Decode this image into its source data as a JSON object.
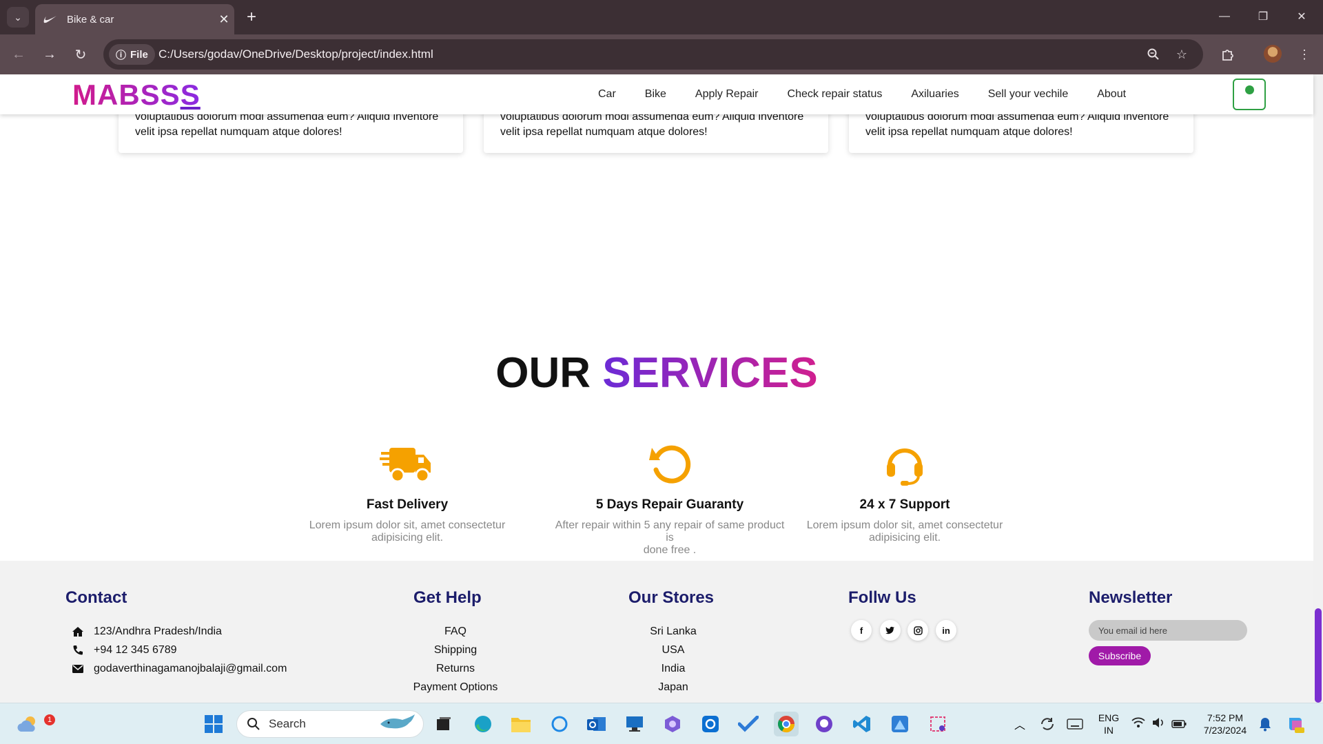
{
  "browser": {
    "tab_title": "Bike & car",
    "url": "C:/Users/godav/OneDrive/Desktop/project/index.html",
    "file_chip": "File"
  },
  "site": {
    "logo": "MABSS",
    "logo_last": "S",
    "nav": [
      "Car",
      "Bike",
      "Apply Repair",
      "Check repair status",
      "Axiluaries",
      "Sell your vechile",
      "About"
    ]
  },
  "cards": [
    {
      "text_line1": "voluptatibus dolorum modi assumenda eum? Aliquid inventore",
      "text_line2": "velit ipsa repellat numquam atque dolores!"
    },
    {
      "text_line1": "voluptatibus dolorum modi assumenda eum? Aliquid inventore",
      "text_line2": "velit ipsa repellat numquam atque dolores!"
    },
    {
      "text_line1": "voluptatibus dolorum modi assumenda eum? Aliquid inventore",
      "text_line2": "velit ipsa repellat numquam atque dolores!"
    }
  ],
  "services": {
    "title_part1": "OUR",
    "title_part2": "SERVICES",
    "items": [
      {
        "icon": "truck-fast-icon",
        "title": "Fast Delivery",
        "desc_line1": "Lorem ipsum dolor sit, amet consectetur",
        "desc_line2": "adipisicing elit."
      },
      {
        "icon": "rotate-left-icon",
        "title": "5 Days Repair Guaranty",
        "desc_line1": "After repair within 5 any repair of same product is",
        "desc_line2": "done free ."
      },
      {
        "icon": "headset-icon",
        "title": "24 x 7 Support",
        "desc_line1": "Lorem ipsum dolor sit, amet consectetur",
        "desc_line2": "adipisicing elit."
      }
    ],
    "icon_color": "#f5a100"
  },
  "footer": {
    "contact": {
      "heading": "Contact",
      "address": "123/Andhra Pradesh/India",
      "phone": "+94 12 345 6789",
      "email": "godaverthinagamanojbalaji@gmail.com"
    },
    "help": {
      "heading": "Get Help",
      "links": [
        "FAQ",
        "Shipping",
        "Returns",
        "Payment Options"
      ]
    },
    "stores": {
      "heading": "Our Stores",
      "links": [
        "Sri Lanka",
        "USA",
        "India",
        "Japan"
      ]
    },
    "follow": {
      "heading": "Follw Us",
      "icons": [
        "facebook-icon",
        "twitter-icon",
        "instagram-icon",
        "linkedin-icon"
      ]
    },
    "newsletter": {
      "heading": "Newsletter",
      "placeholder": "You email id here",
      "button": "Subscribe"
    },
    "heading_color": "#1c1d6b"
  },
  "taskbar": {
    "search_label": "Search",
    "weather_badge": "1",
    "lang_line1": "ENG",
    "lang_line2": "IN",
    "time": "7:52 PM",
    "date": "7/23/2024"
  }
}
